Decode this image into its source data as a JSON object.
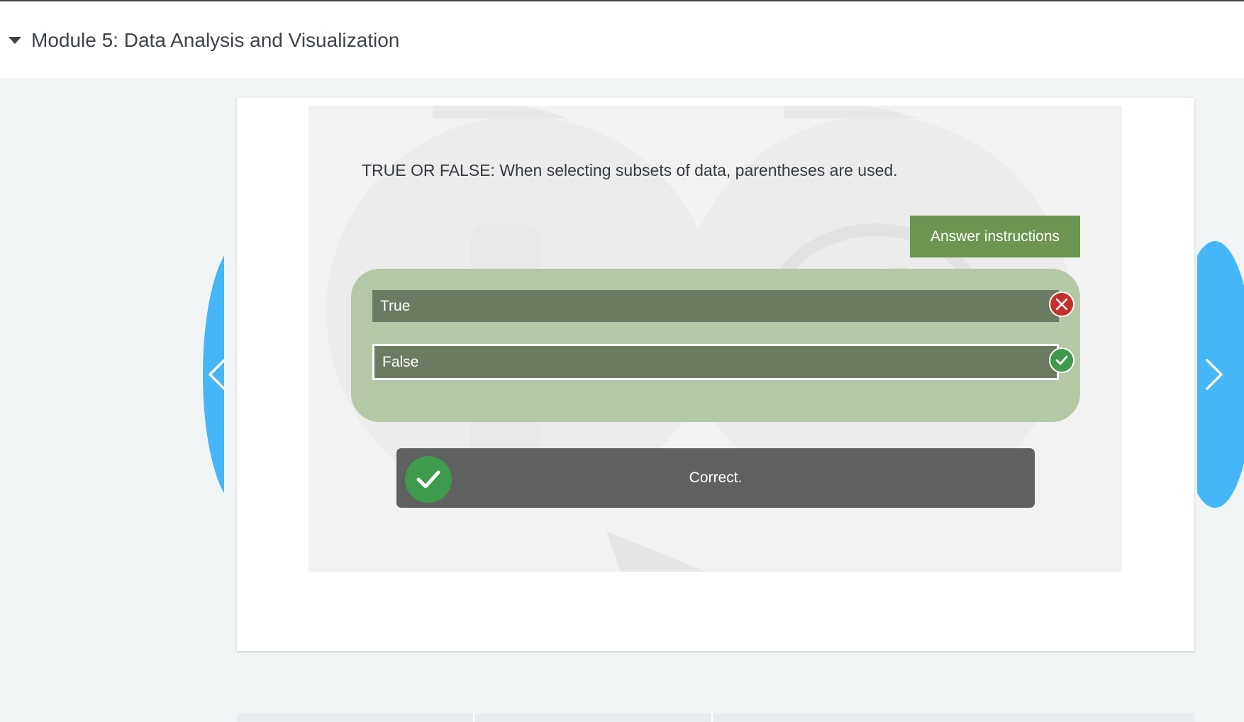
{
  "module": {
    "title": "Module 5: Data Analysis and Visualization",
    "caret_icon": "caret-down-icon"
  },
  "question": {
    "text": "TRUE OR FALSE: When selecting subsets of data, parentheses are used."
  },
  "answer_instructions": {
    "label": "Answer instructions"
  },
  "options": [
    {
      "label": "True",
      "status": "incorrect",
      "status_icon": "x-circle-icon"
    },
    {
      "label": "False",
      "status": "correct",
      "status_icon": "check-circle-icon",
      "selected": true
    }
  ],
  "feedback": {
    "text": "Correct.",
    "icon": "check-circle-icon"
  },
  "navigation": {
    "prev_icon": "chevron-left-icon",
    "next_icon": "chevron-right-icon"
  },
  "colors": {
    "accent_blue": "#45b6f7",
    "button_green": "#6b9550",
    "panel_green": "#b4c8a6",
    "option_bg": "#6b7a61",
    "correct_green": "#3e9a4c",
    "incorrect_red": "#c4302b",
    "feedback_bg": "#5f6060"
  }
}
